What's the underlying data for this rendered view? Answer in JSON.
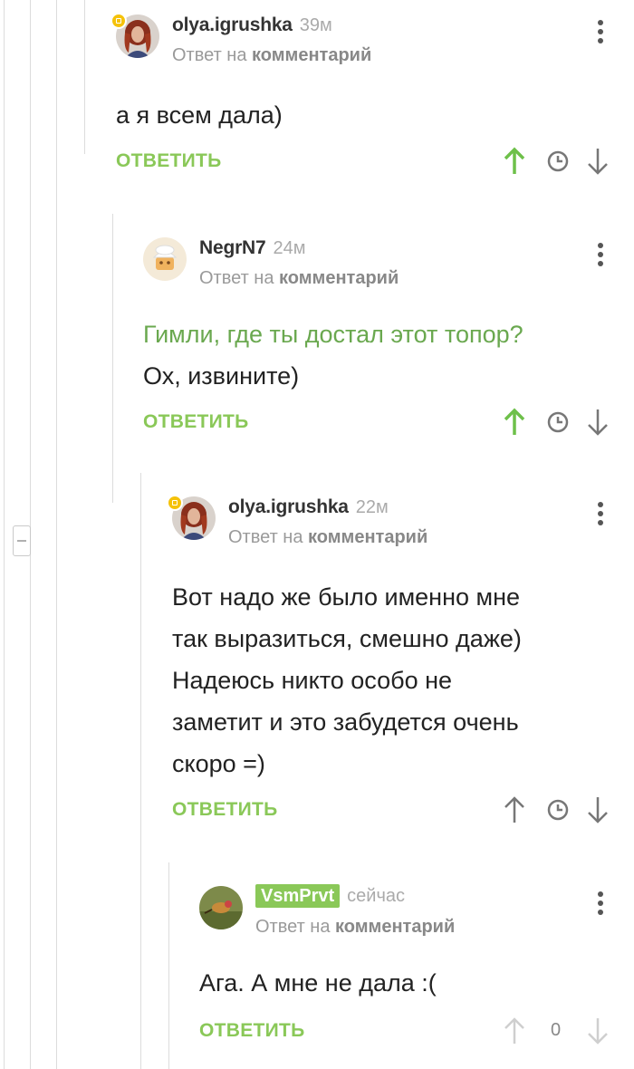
{
  "comments": [
    {
      "author": "olya.igrushka",
      "time": "39м",
      "reply_prefix": "Ответ на",
      "reply_link": "комментарий",
      "lines": [
        "а я всем дала)"
      ],
      "reply_label": "ОТВЕТИТЬ",
      "upvote_state": "active"
    },
    {
      "author": "NegrN7",
      "time": "24м",
      "reply_prefix": "Ответ на",
      "reply_link": "комментарий",
      "quote": "Гимли, где ты достал этот топор?",
      "lines": [
        "Ох, извините)"
      ],
      "reply_label": "ОТВЕТИТЬ",
      "upvote_state": "active"
    },
    {
      "author": "olya.igrushka",
      "time": "22м",
      "reply_prefix": "Ответ на",
      "reply_link": "комментарий",
      "lines": [
        "Вот надо же было именно мне",
        "так выразиться, смешно даже)",
        "Надеюсь никто особо не",
        "заметит и это забудется очень",
        "скоро =)"
      ],
      "reply_label": "ОТВЕТИТЬ",
      "upvote_state": "neutral"
    },
    {
      "author": "VsmPrvt",
      "time": "сейчас",
      "reply_prefix": "Ответ на",
      "reply_link": "комментарий",
      "lines": [
        "Ага. А мне не дала :("
      ],
      "reply_label": "ОТВЕТИТЬ",
      "upvote_state": "disabled",
      "score": "0"
    }
  ],
  "icons": {
    "upvote": "arrow-up-icon",
    "history": "clock-icon",
    "downvote": "arrow-down-icon",
    "menu": "more-vertical-icon",
    "collapse": "minus-icon"
  },
  "colors": {
    "accent_green": "#8ac858",
    "quote_green": "#6aa84f",
    "badge_yellow": "#f5c20a"
  }
}
